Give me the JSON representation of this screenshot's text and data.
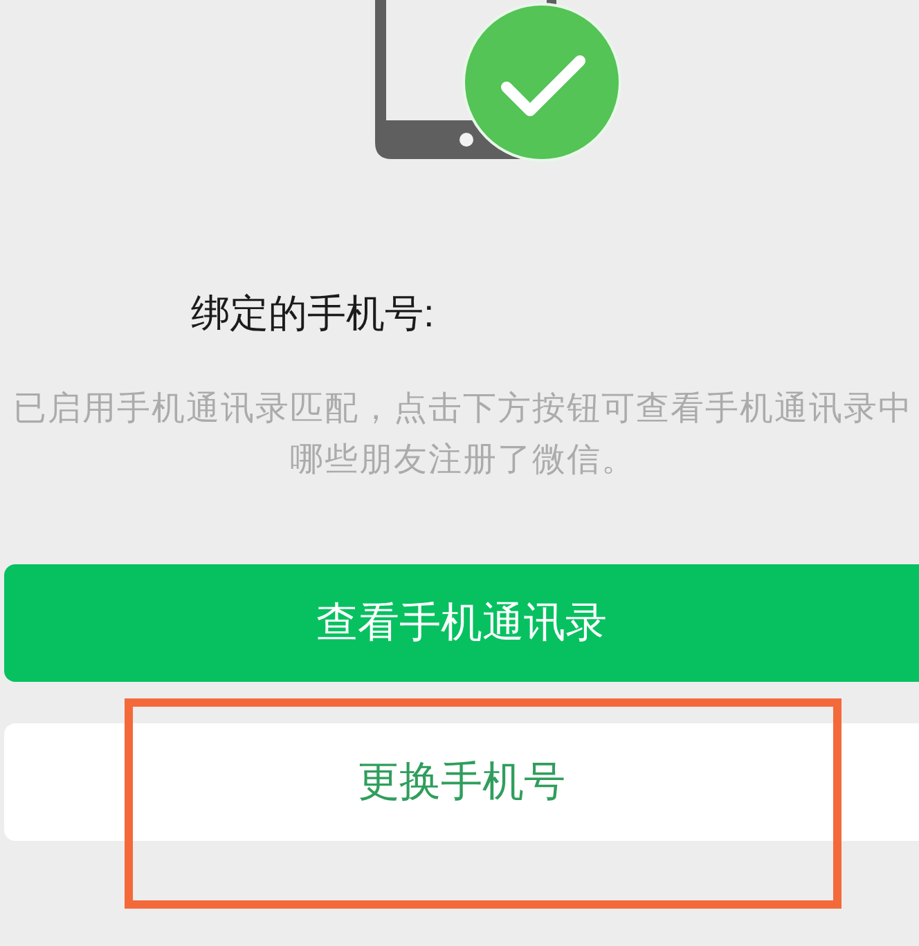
{
  "binding": {
    "title": "绑定的手机号:",
    "description": "已启用手机通讯录匹配，点击下方按钮可查看手机通讯录中哪些朋友注册了微信。"
  },
  "buttons": [
    {
      "label": "查看手机通讯录",
      "kind": "primary",
      "highlighted": false
    },
    {
      "label": "更换手机号",
      "kind": "secondary",
      "highlighted": true
    }
  ]
}
